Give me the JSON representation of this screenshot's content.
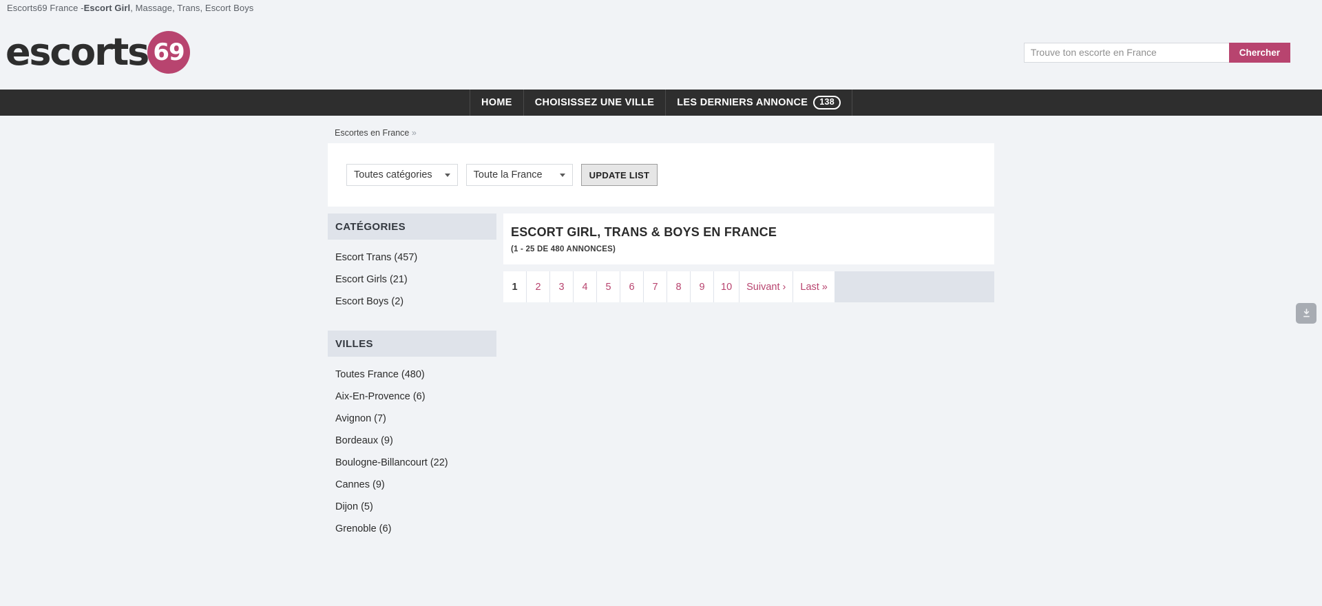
{
  "browser": {
    "title_prefix": "Escorts69 France - ",
    "title_bold": "Escort Girl",
    "title_suffix": ", Massage, Trans, Escort Boys"
  },
  "header": {
    "logo_word": "escorts",
    "logo_badge": "69",
    "search": {
      "placeholder": "Trouve ton escorte en France",
      "value": "",
      "button_label": "Chercher"
    }
  },
  "nav": {
    "items": [
      {
        "label": "HOME",
        "badge": ""
      },
      {
        "label": "CHOISISSEZ UNE VILLE",
        "badge": ""
      },
      {
        "label": "LES DERNIERS ANNONCE",
        "badge": "138"
      }
    ]
  },
  "breadcrumb": {
    "label": "Escortes en France",
    "chevron": "»"
  },
  "filters": {
    "category_select": "Toutes catégories",
    "region_select": "Toute la France",
    "update_button": "UPDATE LIST"
  },
  "sidebar": {
    "categories": {
      "heading": "CATÉGORIES",
      "items": [
        {
          "label": "Escort Trans (457)"
        },
        {
          "label": "Escort Girls (21)"
        },
        {
          "label": "Escort Boys (2)"
        }
      ]
    },
    "villes": {
      "heading": "VILLES",
      "items": [
        {
          "label": "Toutes France (480)"
        },
        {
          "label": "Aix-En-Provence (6)"
        },
        {
          "label": "Avignon (7)"
        },
        {
          "label": "Bordeaux (9)"
        },
        {
          "label": "Boulogne-Billancourt (22)"
        },
        {
          "label": "Cannes (9)"
        },
        {
          "label": "Dijon (5)"
        },
        {
          "label": "Grenoble (6)"
        }
      ]
    }
  },
  "main": {
    "title": "ESCORT GIRL, TRANS & BOYS EN FRANCE",
    "subtitle": "(1 - 25 DE 480 ANNONCES)",
    "pagination": [
      {
        "label": "1",
        "active": true
      },
      {
        "label": "2",
        "active": false
      },
      {
        "label": "3",
        "active": false
      },
      {
        "label": "4",
        "active": false
      },
      {
        "label": "5",
        "active": false
      },
      {
        "label": "6",
        "active": false
      },
      {
        "label": "7",
        "active": false
      },
      {
        "label": "8",
        "active": false
      },
      {
        "label": "9",
        "active": false
      },
      {
        "label": "10",
        "active": false
      },
      {
        "label": "Suivant ›",
        "active": false
      },
      {
        "label": "Last »",
        "active": false
      }
    ]
  },
  "widget": {
    "download_icon": "download-icon"
  },
  "colors": {
    "brand": "#b8446f",
    "nav_bg": "#2e2e2e",
    "page_bg": "#f1f3f6",
    "panel_head_bg": "#dfe3ea"
  }
}
